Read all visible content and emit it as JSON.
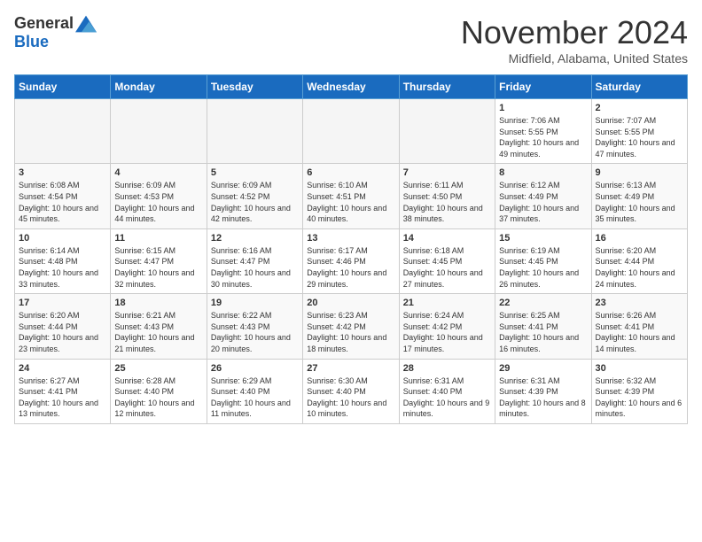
{
  "logo": {
    "general": "General",
    "blue": "Blue"
  },
  "header": {
    "month": "November 2024",
    "location": "Midfield, Alabama, United States"
  },
  "weekdays": [
    "Sunday",
    "Monday",
    "Tuesday",
    "Wednesday",
    "Thursday",
    "Friday",
    "Saturday"
  ],
  "weeks": [
    [
      {
        "day": "",
        "info": ""
      },
      {
        "day": "",
        "info": ""
      },
      {
        "day": "",
        "info": ""
      },
      {
        "day": "",
        "info": ""
      },
      {
        "day": "",
        "info": ""
      },
      {
        "day": "1",
        "info": "Sunrise: 7:06 AM\nSunset: 5:55 PM\nDaylight: 10 hours and 49 minutes."
      },
      {
        "day": "2",
        "info": "Sunrise: 7:07 AM\nSunset: 5:55 PM\nDaylight: 10 hours and 47 minutes."
      }
    ],
    [
      {
        "day": "3",
        "info": "Sunrise: 6:08 AM\nSunset: 4:54 PM\nDaylight: 10 hours and 45 minutes."
      },
      {
        "day": "4",
        "info": "Sunrise: 6:09 AM\nSunset: 4:53 PM\nDaylight: 10 hours and 44 minutes."
      },
      {
        "day": "5",
        "info": "Sunrise: 6:09 AM\nSunset: 4:52 PM\nDaylight: 10 hours and 42 minutes."
      },
      {
        "day": "6",
        "info": "Sunrise: 6:10 AM\nSunset: 4:51 PM\nDaylight: 10 hours and 40 minutes."
      },
      {
        "day": "7",
        "info": "Sunrise: 6:11 AM\nSunset: 4:50 PM\nDaylight: 10 hours and 38 minutes."
      },
      {
        "day": "8",
        "info": "Sunrise: 6:12 AM\nSunset: 4:49 PM\nDaylight: 10 hours and 37 minutes."
      },
      {
        "day": "9",
        "info": "Sunrise: 6:13 AM\nSunset: 4:49 PM\nDaylight: 10 hours and 35 minutes."
      }
    ],
    [
      {
        "day": "10",
        "info": "Sunrise: 6:14 AM\nSunset: 4:48 PM\nDaylight: 10 hours and 33 minutes."
      },
      {
        "day": "11",
        "info": "Sunrise: 6:15 AM\nSunset: 4:47 PM\nDaylight: 10 hours and 32 minutes."
      },
      {
        "day": "12",
        "info": "Sunrise: 6:16 AM\nSunset: 4:47 PM\nDaylight: 10 hours and 30 minutes."
      },
      {
        "day": "13",
        "info": "Sunrise: 6:17 AM\nSunset: 4:46 PM\nDaylight: 10 hours and 29 minutes."
      },
      {
        "day": "14",
        "info": "Sunrise: 6:18 AM\nSunset: 4:45 PM\nDaylight: 10 hours and 27 minutes."
      },
      {
        "day": "15",
        "info": "Sunrise: 6:19 AM\nSunset: 4:45 PM\nDaylight: 10 hours and 26 minutes."
      },
      {
        "day": "16",
        "info": "Sunrise: 6:20 AM\nSunset: 4:44 PM\nDaylight: 10 hours and 24 minutes."
      }
    ],
    [
      {
        "day": "17",
        "info": "Sunrise: 6:20 AM\nSunset: 4:44 PM\nDaylight: 10 hours and 23 minutes."
      },
      {
        "day": "18",
        "info": "Sunrise: 6:21 AM\nSunset: 4:43 PM\nDaylight: 10 hours and 21 minutes."
      },
      {
        "day": "19",
        "info": "Sunrise: 6:22 AM\nSunset: 4:43 PM\nDaylight: 10 hours and 20 minutes."
      },
      {
        "day": "20",
        "info": "Sunrise: 6:23 AM\nSunset: 4:42 PM\nDaylight: 10 hours and 18 minutes."
      },
      {
        "day": "21",
        "info": "Sunrise: 6:24 AM\nSunset: 4:42 PM\nDaylight: 10 hours and 17 minutes."
      },
      {
        "day": "22",
        "info": "Sunrise: 6:25 AM\nSunset: 4:41 PM\nDaylight: 10 hours and 16 minutes."
      },
      {
        "day": "23",
        "info": "Sunrise: 6:26 AM\nSunset: 4:41 PM\nDaylight: 10 hours and 14 minutes."
      }
    ],
    [
      {
        "day": "24",
        "info": "Sunrise: 6:27 AM\nSunset: 4:41 PM\nDaylight: 10 hours and 13 minutes."
      },
      {
        "day": "25",
        "info": "Sunrise: 6:28 AM\nSunset: 4:40 PM\nDaylight: 10 hours and 12 minutes."
      },
      {
        "day": "26",
        "info": "Sunrise: 6:29 AM\nSunset: 4:40 PM\nDaylight: 10 hours and 11 minutes."
      },
      {
        "day": "27",
        "info": "Sunrise: 6:30 AM\nSunset: 4:40 PM\nDaylight: 10 hours and 10 minutes."
      },
      {
        "day": "28",
        "info": "Sunrise: 6:31 AM\nSunset: 4:40 PM\nDaylight: 10 hours and 9 minutes."
      },
      {
        "day": "29",
        "info": "Sunrise: 6:31 AM\nSunset: 4:39 PM\nDaylight: 10 hours and 8 minutes."
      },
      {
        "day": "30",
        "info": "Sunrise: 6:32 AM\nSunset: 4:39 PM\nDaylight: 10 hours and 6 minutes."
      }
    ]
  ]
}
